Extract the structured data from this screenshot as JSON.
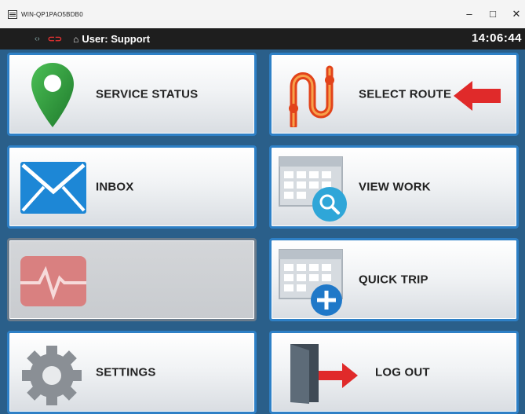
{
  "window": {
    "title": "WIN-QP1PAO5BDB0"
  },
  "window_controls": {
    "minimize": "–",
    "maximize": "□",
    "close": "✕"
  },
  "topbar": {
    "user_label": "User: Support",
    "clock": "14:06:44"
  },
  "tiles": {
    "service_status": "SERVICE STATUS",
    "select_route": "SELECT ROUTE",
    "inbox": "INBOX",
    "view_work": "VIEW WORK",
    "health": "",
    "quick_trip": "QUICK TRIP",
    "settings": "SETTINGS",
    "log_out": "LOG OUT"
  },
  "icons": {
    "service_status": "map-pin-icon",
    "select_route": "route-icon",
    "select_route_arrow": "arrow-left-icon",
    "inbox": "envelope-icon",
    "view_work": "calendar-search-icon",
    "health": "heartbeat-icon",
    "quick_trip": "calendar-add-icon",
    "settings": "gear-icon",
    "log_out": "exit-door-icon"
  },
  "colors": {
    "tile_border": "#2e80c6",
    "topbar_bg": "#1e1e1e",
    "pin": "#2e9a3e",
    "route": "#e2431a",
    "arrow": "#e02a2a",
    "envelope": "#1d87d6",
    "heart_disabled": "#d98080"
  }
}
